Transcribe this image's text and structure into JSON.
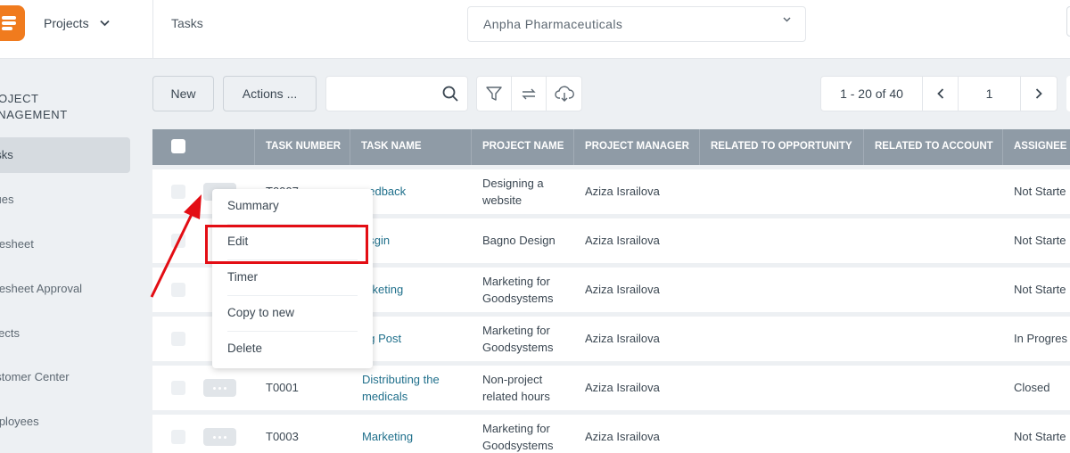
{
  "topbar": {
    "app_name": "Projects",
    "page_title": "Tasks",
    "company": "Anpha Pharmaceuticals"
  },
  "sidebar": {
    "heading_line1": "ROJECT",
    "heading_line2": "ANAGEMENT",
    "items": [
      {
        "label": "asks",
        "active": true
      },
      {
        "label": "sues"
      },
      {
        "label": "mesheet"
      },
      {
        "label": "mesheet Approval"
      },
      {
        "label": "ojects"
      },
      {
        "label": "ustomer Center"
      },
      {
        "label": "mployees"
      }
    ]
  },
  "toolbar": {
    "new_label": "New",
    "actions_label": "Actions ...",
    "search_placeholder": ""
  },
  "pager": {
    "range": "1 - 20 of 40",
    "page": "1"
  },
  "table": {
    "columns": [
      "TASK NUMBER",
      "TASK NAME",
      "PROJECT NAME",
      "PROJECT MANAGER",
      "RELATED TO OPPORTUNITY",
      "RELATED TO ACCOUNT",
      "ASSIGNEE S"
    ],
    "rows": [
      {
        "task_number": "T0007",
        "task_name": "eedback",
        "project_l1": "Designing a",
        "project_l2": "website",
        "manager": "Aziza Israilova",
        "status": "Not Starte"
      },
      {
        "task_number": "",
        "task_name": "esgin",
        "project_l1": "Bagno Design",
        "project_l2": "",
        "manager": "Aziza Israilova",
        "status": "Not Starte"
      },
      {
        "task_number": "",
        "task_name": "arketing",
        "project_l1": "Marketing for",
        "project_l2": "Goodsystems",
        "manager": "Aziza Israilova",
        "status": "Not Starte"
      },
      {
        "task_number": "",
        "task_name": "og Post",
        "project_l1": "Marketing for",
        "project_l2": "Goodsystems",
        "manager": "Aziza Israilova",
        "status": "In Progres"
      },
      {
        "task_number": "T0001",
        "task_name_l1": "Distributing the",
        "task_name_l2": "medicals",
        "project_l1": "Non-project",
        "project_l2": "related hours",
        "manager": "Aziza Israilova",
        "status": "Closed"
      },
      {
        "task_number": "T0003",
        "task_name": "Marketing",
        "project_l1": "Marketing for",
        "project_l2": "Goodsystems",
        "manager": "Aziza Israilova",
        "status": "Not Starte"
      }
    ]
  },
  "context_menu": {
    "items": [
      "Summary",
      "Edit",
      "Timer",
      "Copy to new",
      "Delete"
    ]
  },
  "colors": {
    "brand": "#f07b1e",
    "header": "#8f9ba6",
    "link": "#1f6f8b",
    "annotation": "#e30d14"
  }
}
